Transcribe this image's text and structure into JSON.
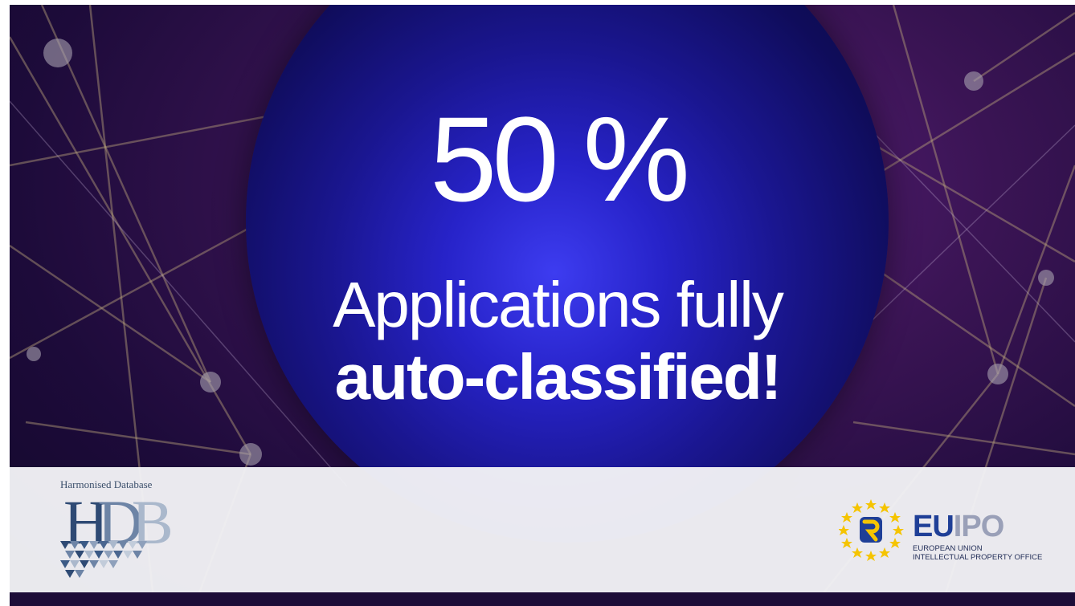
{
  "headline": {
    "percent": "50 %",
    "line1": "Applications fully",
    "line2": "auto-classified!"
  },
  "logos": {
    "hdb": {
      "title": "Harmonised Database",
      "letters": [
        "H",
        "D",
        "B"
      ]
    },
    "euipo": {
      "eu": "EU",
      "ipo": "IPO",
      "sub_line1": "EUROPEAN UNION",
      "sub_line2": "INTELLECTUAL PROPERTY OFFICE"
    }
  },
  "colors": {
    "circle": "#2723c9",
    "background": "#3a1454",
    "footer": "#f2f2f6",
    "eu_blue": "#1f3f97",
    "ipo_grey": "#9aa0b8",
    "stars": "#f5c400"
  }
}
